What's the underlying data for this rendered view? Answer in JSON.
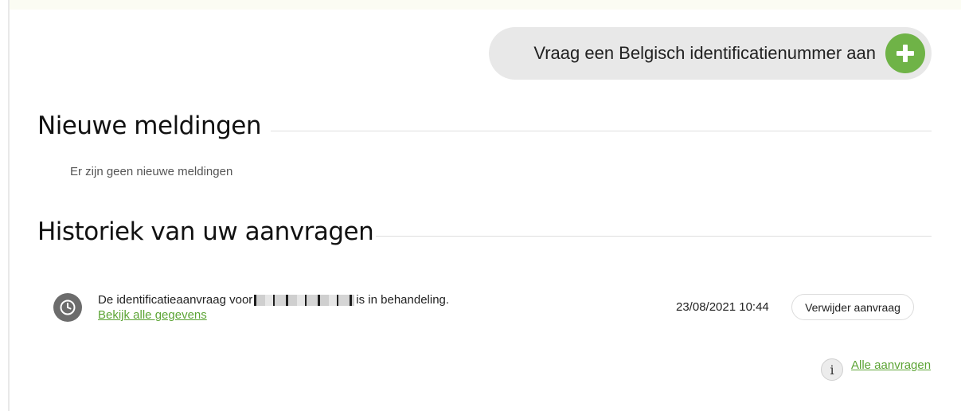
{
  "request_button": {
    "label": "Vraag een Belgisch identificatienummer aan",
    "icon": "plus-icon"
  },
  "notifications": {
    "title": "Nieuwe meldingen",
    "empty_message": "Er zijn geen nieuwe meldingen"
  },
  "history": {
    "title": "Historiek van uw aanvragen",
    "items": [
      {
        "status_icon": "clock-icon",
        "text_before": "De identificatieaanvraag voor",
        "text_after": "is in behandeling.",
        "details_link": "Bekijk alle gegevens",
        "date": "23/08/2021 10:44",
        "delete_label": "Verwijder aanvraag"
      }
    ],
    "info_icon": "i",
    "all_requests_link": "Alle aanvragen"
  },
  "colors": {
    "accent_green": "#6fb347",
    "link_green": "#5ca435",
    "button_bg": "#e8e8e8"
  }
}
